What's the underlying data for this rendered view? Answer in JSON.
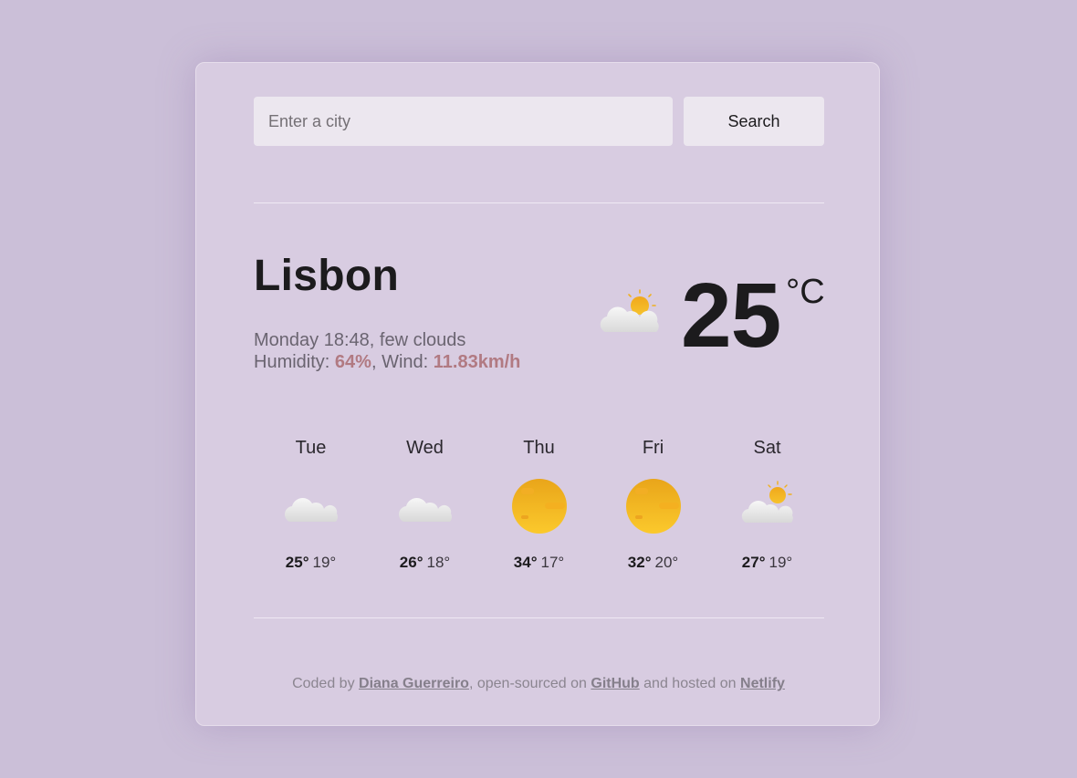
{
  "search": {
    "placeholder": "Enter a city",
    "value": "",
    "button_label": "Search"
  },
  "current": {
    "city": "Lisbon",
    "datetime": "Monday 18:48",
    "description": "few clouds",
    "humidity_label": "Humidity: ",
    "humidity": "64%",
    "wind_label": "Wind: ",
    "wind": "11.83km/h",
    "icon": "partly-cloudy-icon",
    "temperature": "25",
    "unit": "°C"
  },
  "forecast": [
    {
      "day": "Tue",
      "icon": "cloud-icon",
      "max": "25°",
      "min": "19°"
    },
    {
      "day": "Wed",
      "icon": "cloud-icon",
      "max": "26°",
      "min": "18°"
    },
    {
      "day": "Thu",
      "icon": "sun-icon",
      "max": "34°",
      "min": "17°"
    },
    {
      "day": "Fri",
      "icon": "sun-icon",
      "max": "32°",
      "min": "20°"
    },
    {
      "day": "Sat",
      "icon": "partly-cloudy-icon",
      "max": "27°",
      "min": "19°"
    }
  ],
  "footer": {
    "prefix": "Coded by ",
    "author": "Diana Guerreiro",
    "middle": ", open-sourced on ",
    "github": "GitHub",
    "middle2": " and hosted on ",
    "netlify": "Netlify"
  },
  "colors": {
    "background": "#cbbfd8",
    "card": "#d8cce1",
    "highlight": "#b17a82",
    "sun": "#f4b21b"
  }
}
